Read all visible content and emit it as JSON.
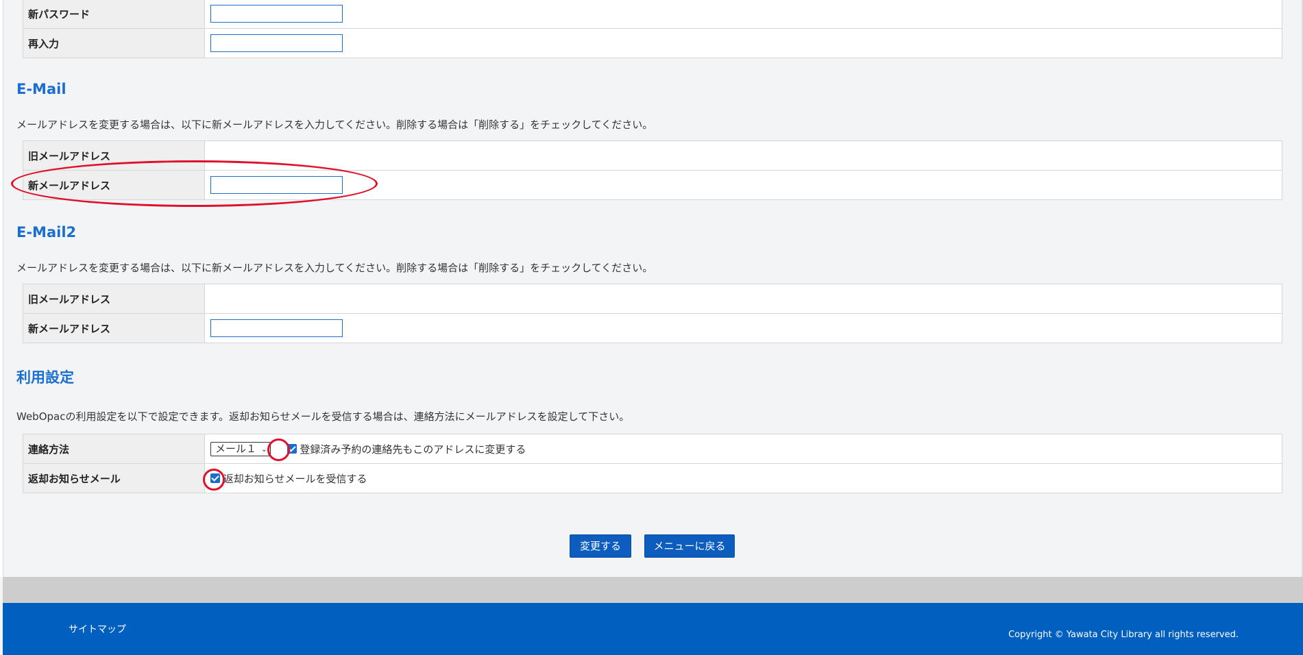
{
  "password": {
    "new_label": "新パスワード",
    "reenter_label": "再入力"
  },
  "email1": {
    "heading": "E-Mail",
    "description": "メールアドレスを変更する場合は、以下に新メールアドレスを入力してください。削除する場合は「削除する」をチェックしてください。",
    "old_label": "旧メールアドレス",
    "new_label": "新メールアドレス"
  },
  "email2": {
    "heading": "E-Mail2",
    "description": "メールアドレスを変更する場合は、以下に新メールアドレスを入力してください。削除する場合は「削除する」をチェックしてください。",
    "old_label": "旧メールアドレス",
    "new_label": "新メールアドレス"
  },
  "usage": {
    "heading": "利用設定",
    "description": "WebOpacの利用設定を以下で設定できます。返却お知らせメールを受信する場合は、連絡方法にメールアドレスを設定して下さい。",
    "contact_label": "連絡方法",
    "contact_select_value": "メール１",
    "contact_checkbox_label": "登録済み予約の連絡先もこのアドレスに変更する",
    "return_label": "返却お知らせメール",
    "return_checkbox_label": "返却お知らせメールを受信する"
  },
  "buttons": {
    "submit": "変更する",
    "back": "メニューに戻る"
  },
  "footer": {
    "sitemap": "サイトマップ",
    "copyright": "Copyright © Yawata City Library all rights reserved."
  },
  "colors": {
    "accent": "#1a6ecf",
    "footer_bg": "#005fbf",
    "annotation": "#e0102a"
  }
}
